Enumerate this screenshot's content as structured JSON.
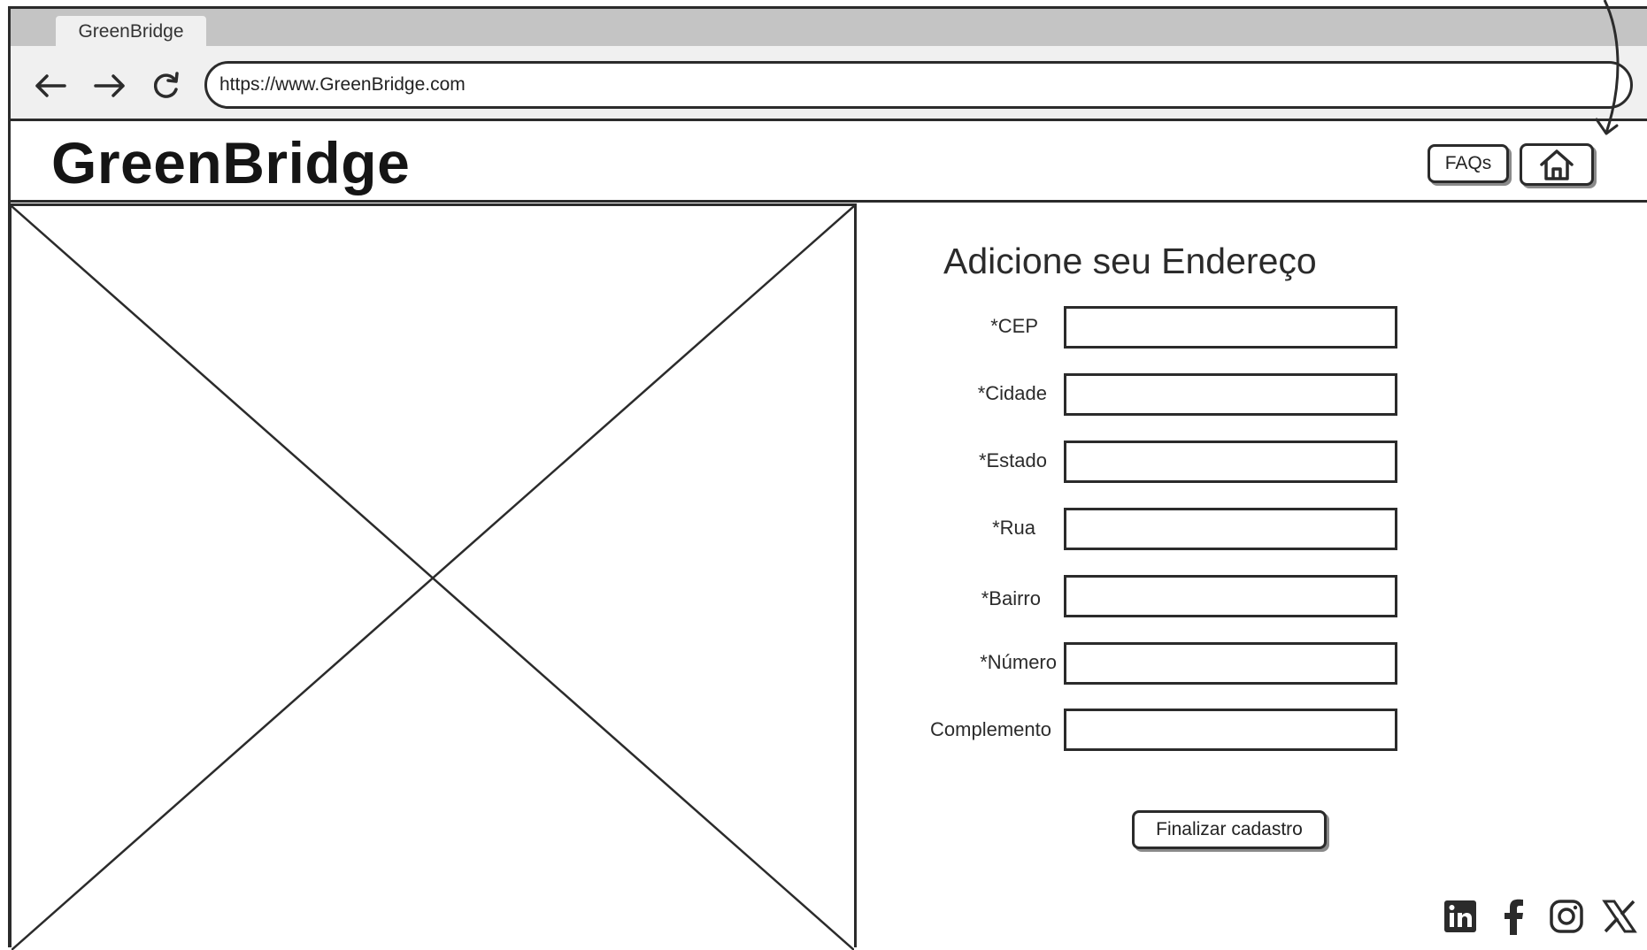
{
  "browser": {
    "tab_title": "GreenBridge",
    "url": "https://www.GreenBridge.com",
    "nav": {
      "back_icon": "arrow-left-icon",
      "forward_icon": "arrow-right-icon",
      "reload_icon": "reload-icon"
    }
  },
  "header": {
    "logo": "GreenBridge",
    "faq_label": "FAQs",
    "home_icon": "home-icon"
  },
  "image_placeholder": {
    "icon": "image-placeholder-icon"
  },
  "form": {
    "title": "Adicione seu Endereço",
    "fields": [
      {
        "label": "*CEP",
        "value": ""
      },
      {
        "label": "*Cidade",
        "value": ""
      },
      {
        "label": "*Estado",
        "value": ""
      },
      {
        "label": "*Rua",
        "value": ""
      },
      {
        "label": "*Bairro",
        "value": ""
      },
      {
        "label": "*Número",
        "value": ""
      },
      {
        "label": "Complemento",
        "value": ""
      }
    ],
    "submit_label": "Finalizar cadastro"
  },
  "footer": {
    "social_icons": [
      "linkedin-icon",
      "facebook-icon",
      "instagram-icon",
      "x-icon"
    ]
  },
  "colors": {
    "ink": "#2b2b2b",
    "chrome_gray": "#c4c4c4",
    "toolbar_gray": "#f0f0f0",
    "shadow_gray": "#8a8a8a"
  }
}
